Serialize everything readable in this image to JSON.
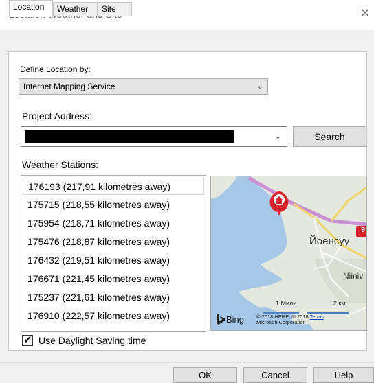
{
  "window": {
    "title": "Location Weather and Site",
    "close_glyph": "✕"
  },
  "tabs": [
    {
      "label": "Location"
    },
    {
      "label": "Weather"
    },
    {
      "label": "Site"
    }
  ],
  "location": {
    "define_label": "Define Location by:",
    "define_value": "Internet Mapping Service",
    "project_address_label": "Project Address:",
    "search_button": "Search",
    "weather_stations_label": "Weather Stations:",
    "stations": [
      "176193 (217,91 kilometres away)",
      "175715 (218,55 kilometres away)",
      "175954 (218,71 kilometres away)",
      "175476 (218,87 kilometres away)",
      "176432 (219,51 kilometres away)",
      "176671 (221,45 kilometres away)",
      "175237 (221,61 kilometres away)",
      "176910 (222,57 kilometres away)"
    ],
    "daylight_saving_label": "Use Daylight Saving time",
    "daylight_saving_checked": true
  },
  "map": {
    "city_label": "Йоенсуу",
    "place_label": "Niiniv",
    "road_number": "9",
    "bing_label": "Bing",
    "scale_miles": "1 Мили",
    "scale_km": "2 км",
    "copyright_line1": "© 2018 HERE, © 2018",
    "copyright_terms": "Terms",
    "copyright_line2": "Microsoft Corporation",
    "colors": {
      "water": "#a6c7e6",
      "land": "#e4e8de",
      "pin": "#d8232a",
      "road_major": "#c98fd0",
      "road_yellow": "#f2d36a"
    }
  },
  "footer": {
    "ok": "OK",
    "cancel": "Cancel",
    "help": "Help"
  }
}
